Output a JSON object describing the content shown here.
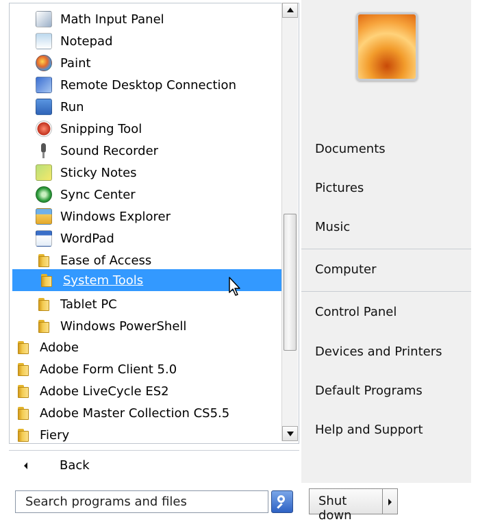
{
  "program_list": {
    "items": [
      {
        "label": "Math Input Panel",
        "icon": "pen-icon"
      },
      {
        "label": "Notepad",
        "icon": "notepad-icon"
      },
      {
        "label": "Paint",
        "icon": "paint-palette-icon"
      },
      {
        "label": "Remote Desktop Connection",
        "icon": "remote-desktop-icon"
      },
      {
        "label": "Run",
        "icon": "run-icon"
      },
      {
        "label": "Snipping Tool",
        "icon": "scissors-icon"
      },
      {
        "label": "Sound Recorder",
        "icon": "microphone-icon"
      },
      {
        "label": "Sticky Notes",
        "icon": "sticky-notes-icon"
      },
      {
        "label": "Sync Center",
        "icon": "sync-icon"
      },
      {
        "label": "Windows Explorer",
        "icon": "explorer-folder-icon"
      },
      {
        "label": "WordPad",
        "icon": "wordpad-icon"
      },
      {
        "label": "Ease of Access",
        "icon": "folder-icon"
      },
      {
        "label": "System Tools",
        "icon": "folder-icon",
        "selected": true
      },
      {
        "label": "Tablet PC",
        "icon": "folder-icon"
      },
      {
        "label": "Windows PowerShell",
        "icon": "folder-icon"
      },
      {
        "label": "Adobe",
        "icon": "folder-icon"
      },
      {
        "label": "Adobe Form Client 5.0",
        "icon": "folder-icon"
      },
      {
        "label": "Adobe LiveCycle ES2",
        "icon": "folder-icon"
      },
      {
        "label": "Adobe Master Collection CS5.5",
        "icon": "folder-icon"
      },
      {
        "label": "Fiery",
        "icon": "folder-icon"
      }
    ],
    "back_label": "Back"
  },
  "search": {
    "placeholder": "Search programs and files",
    "button_icon": "search-icon"
  },
  "right_pane": {
    "user_picture": "flower-user-picture",
    "links": {
      "documents": "Documents",
      "pictures": "Pictures",
      "music": "Music",
      "computer": "Computer",
      "control_panel": "Control Panel",
      "devices_printers": "Devices and Printers",
      "default_programs": "Default Programs",
      "help_support": "Help and Support"
    }
  },
  "shutdown": {
    "label": "Shut down",
    "arrow_icon": "chevron-right-icon"
  },
  "colors": {
    "selection": "#3399ff",
    "right_pane_bg": "#f0f0f0",
    "folder_yellow": "#f3cc52"
  }
}
